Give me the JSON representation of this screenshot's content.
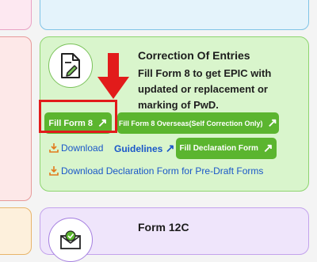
{
  "correction_card": {
    "title": "Correction Of Entries",
    "description": "Fill Form 8 to get EPIC with updated or replacement or marking of PwD.",
    "fill_form_label": "Fill Form 8",
    "overseas_label": "Fill Form 8 Overseas(Self Correction Only)",
    "download_label": "Download",
    "guidelines_label": "Guidelines",
    "declaration_label": "Fill Declaration Form",
    "pre_draft_label": "Download Declaration Form for Pre-Draft Forms"
  },
  "next_card": {
    "title": "Form 12C"
  },
  "colors": {
    "button_green": "#5bb52f",
    "highlight_red": "#e21b1b",
    "link_blue": "#1a57c9",
    "download_orange": "#e27a1c"
  },
  "icons": [
    "form-edit-icon",
    "red-down-arrow",
    "arrow-up-right-icon",
    "download-icon",
    "envelope-check-icon"
  ]
}
